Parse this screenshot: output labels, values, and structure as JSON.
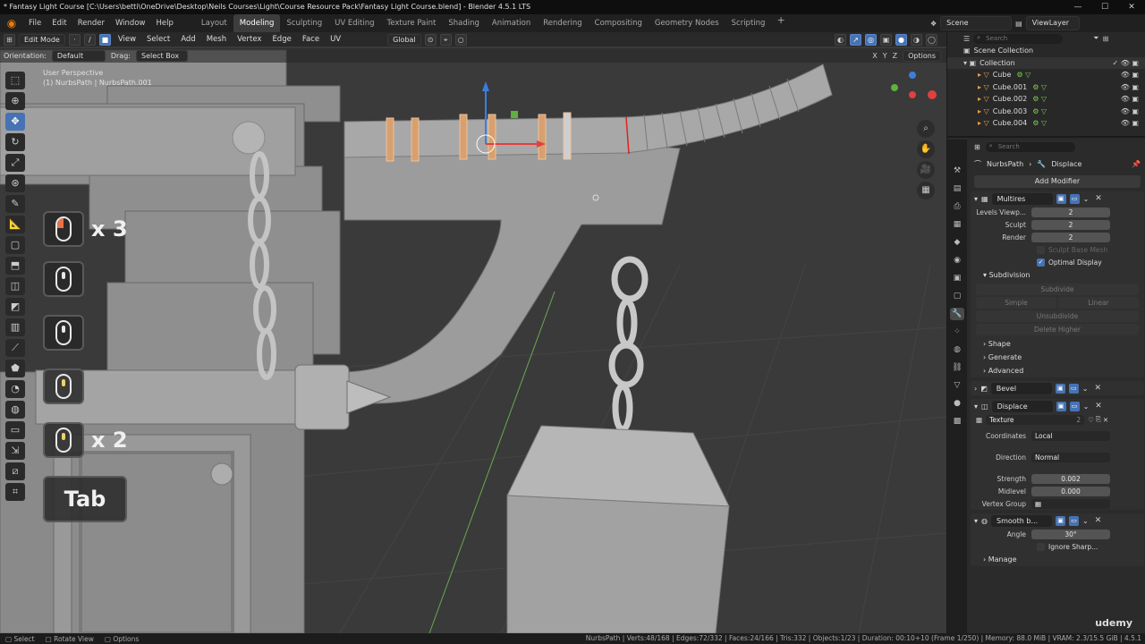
{
  "window": {
    "title": "* Fantasy Light Course [C:\\Users\\betti\\OneDrive\\Desktop\\Neils Courses\\Light\\Course Resource Pack\\Fantasy Light Course.blend] - Blender 4.5.1 LTS"
  },
  "menubar": {
    "items": [
      "File",
      "Edit",
      "Render",
      "Window",
      "Help"
    ],
    "workspaces": [
      "Layout",
      "Modeling",
      "Sculpting",
      "UV Editing",
      "Texture Paint",
      "Shading",
      "Animation",
      "Rendering",
      "Compositing",
      "Geometry Nodes",
      "Scripting"
    ],
    "active_workspace": "Modeling",
    "scene": "Scene",
    "view_layer": "ViewLayer"
  },
  "viewport": {
    "mode": "Edit Mode",
    "menus": [
      "View",
      "Select",
      "Add",
      "Mesh",
      "Vertex",
      "Edge",
      "Face",
      "UV"
    ],
    "transform": "Global",
    "orientation_label": "Orientation:",
    "orientation_value": "Default",
    "drag_label": "Drag:",
    "drag_value": "Select Box",
    "options": "Options",
    "axes": [
      "X",
      "Y",
      "Z"
    ],
    "overlay_line1": "User Perspective",
    "overlay_line2": "(1) NurbsPath | NurbsPath.001"
  },
  "keycasts": [
    {
      "label": "x 3",
      "button": "left"
    },
    {
      "label": "",
      "button": "none"
    },
    {
      "label": "",
      "button": "middle-scroll"
    },
    {
      "label": "",
      "button": "middle"
    },
    {
      "label": "x 2",
      "button": "middle"
    },
    {
      "label": "Tab",
      "button": "key"
    }
  ],
  "outliner": {
    "search_placeholder": "Search",
    "rows": [
      "Scene Collection",
      "Collection",
      "Cube",
      "Cube.001",
      "Cube.002",
      "Cube.003",
      "Cube.004"
    ]
  },
  "properties": {
    "search_placeholder": "Search",
    "breadcrumb_object": "NurbsPath",
    "breadcrumb_modifier": "Displace",
    "add_modifier": "Add Modifier",
    "multires": {
      "name": "Multires",
      "levels_viewport_label": "Levels Viewp...",
      "levels_viewport": "2",
      "sculpt_label": "Sculpt",
      "sculpt": "2",
      "render_label": "Render",
      "render": "2",
      "sculpt_base_mesh": "Sculpt Base Mesh",
      "optimal_display": "Optimal Display",
      "subdivision_header": "Subdivision",
      "subdivide": "Subdivide",
      "simple": "Simple",
      "linear": "Linear",
      "unsubdivide": "Unsubdivide",
      "delete_higher": "Delete Higher",
      "shape": "Shape",
      "generate": "Generate",
      "advanced": "Advanced"
    },
    "bevel": {
      "name": "Bevel"
    },
    "displace": {
      "name": "Displace",
      "texture_label": "Texture",
      "texture_count": "2",
      "coordinates_label": "Coordinates",
      "coordinates": "Local",
      "direction_label": "Direction",
      "direction": "Normal",
      "strength_label": "Strength",
      "strength": "0.002",
      "midlevel_label": "Midlevel",
      "midlevel": "0.000",
      "vertex_group_label": "Vertex Group"
    },
    "smooth": {
      "name": "Smooth b...",
      "angle_label": "Angle",
      "angle": "30°",
      "ignore_sharp": "Ignore Sharp..."
    },
    "manage": "Manage"
  },
  "statusbar": {
    "select": "Select",
    "rotate": "Rotate View",
    "options": "Options",
    "stats": "NurbsPath | Verts:48/168 | Edges:72/332 | Faces:24/166 | Tris:332 | Objects:1/23 | Duration: 00:10+10 (Frame 1/250) | Memory: 88.0 MiB | VRAM: 2.3/15.5 GiB | 4.5.1"
  },
  "watermark": "udemy",
  "colors": {
    "accent": "#4772b3",
    "orange": "#e8a04a",
    "viewport_bg": "#3a3a3a"
  }
}
